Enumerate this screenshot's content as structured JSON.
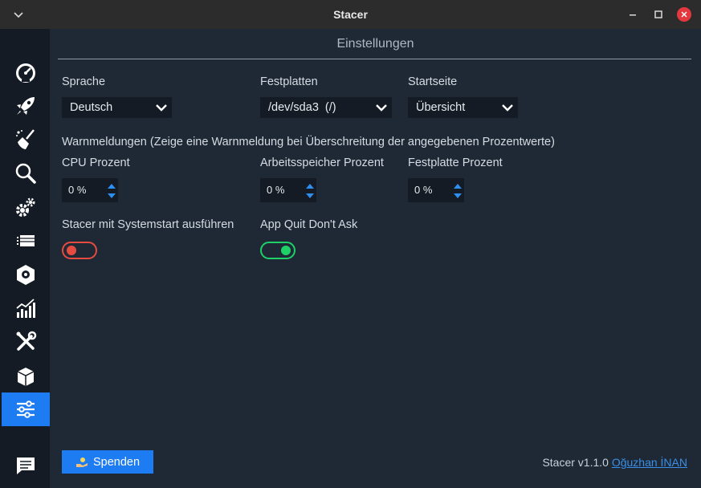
{
  "window": {
    "title": "Stacer"
  },
  "page": {
    "title": "Einstellungen"
  },
  "sidebar": {
    "items": [
      {
        "icon": "speedometer-icon"
      },
      {
        "icon": "rocket-icon"
      },
      {
        "icon": "broom-icon"
      },
      {
        "icon": "magnifier-icon"
      },
      {
        "icon": "gears-icon"
      },
      {
        "icon": "stack-icon"
      },
      {
        "icon": "package-box-icon"
      },
      {
        "icon": "chart-icon"
      },
      {
        "icon": "tools-icon"
      },
      {
        "icon": "box-icon"
      },
      {
        "icon": "sliders-icon",
        "active": true
      }
    ],
    "bottom_icon": "feedback-icon"
  },
  "settings": {
    "language": {
      "label": "Sprache",
      "value": "Deutsch"
    },
    "disks": {
      "label": "Festplatten",
      "value": "/dev/sda3  (/)"
    },
    "startpage": {
      "label": "Startseite",
      "value": "Übersicht"
    },
    "alerts_heading": "Warnmeldungen (Zeige eine Warnmeldung bei Überschreitung der angegebenen Prozentwerte)",
    "cpu": {
      "label": "CPU Prozent",
      "value": "0 %"
    },
    "memory": {
      "label": "Arbeitsspeicher Prozent",
      "value": "0 %"
    },
    "disk": {
      "label": "Festplatte Prozent",
      "value": "0 %"
    },
    "autostart": {
      "label": "Stacer mit Systemstart ausführen",
      "enabled": false
    },
    "app_quit": {
      "label": "App Quit Don't Ask",
      "enabled": true
    }
  },
  "footer": {
    "donate_label": "Spenden",
    "version_text": "Stacer v1.1.0",
    "author_link": "Oğuzhan İNAN"
  },
  "colors": {
    "accent": "#1d7cf2",
    "toggle_off": "#e64b40",
    "toggle_on": "#1fd069",
    "link": "#3a8fe8"
  }
}
